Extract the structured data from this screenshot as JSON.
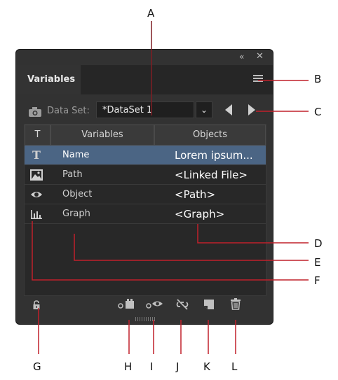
{
  "panel": {
    "tab_label": "Variables",
    "dataset_label": "Data Set:",
    "dataset_value": "*DataSet 1",
    "columns": [
      "T",
      "Variables",
      "Objects"
    ],
    "rows": [
      {
        "icon": "text-icon",
        "name": "Name",
        "object": "Lorem ipsum...",
        "selected": true
      },
      {
        "icon": "image-icon",
        "name": "Path",
        "object": "<Linked File>",
        "selected": false
      },
      {
        "icon": "eye-icon",
        "name": "Object",
        "object": "<Path>",
        "selected": false
      },
      {
        "icon": "graph-icon",
        "name": "Graph",
        "object": "<Graph>",
        "selected": false
      }
    ]
  },
  "callouts": {
    "A": "A",
    "B": "B",
    "C": "C",
    "D": "D",
    "E": "E",
    "F": "F",
    "G": "G",
    "H": "H",
    "I": "I",
    "J": "J",
    "K": "K",
    "L": "L"
  },
  "colors": {
    "callout_line": "#c0202a",
    "selection": "#4b6584"
  }
}
